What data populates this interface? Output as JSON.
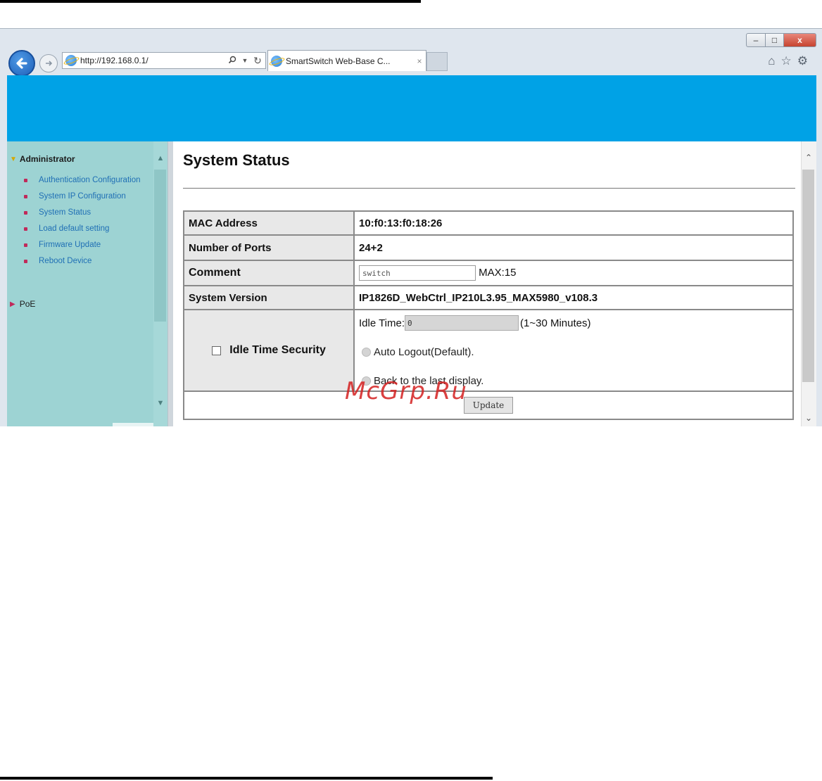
{
  "browser": {
    "address": "http://192.168.0.1/",
    "tab_title": "SmartSwitch Web-Base C...",
    "tab_close": "×",
    "window_controls": {
      "minimize": "–",
      "maximize": "□",
      "close": "x"
    },
    "icons": [
      "back-icon",
      "forward-icon",
      "search-icon",
      "refresh-icon",
      "home-icon",
      "star-icon",
      "gear-icon"
    ]
  },
  "sidebar": {
    "header": "Administrator",
    "items": [
      {
        "label": "Authentication Configuration"
      },
      {
        "label": "System IP Configuration"
      },
      {
        "label": "System Status"
      },
      {
        "label": "Load default setting"
      },
      {
        "label": "Firmware Update"
      },
      {
        "label": "Reboot Device"
      }
    ],
    "poe": "PoE"
  },
  "main": {
    "title": "System Status",
    "rows": {
      "mac_label": "MAC Address",
      "mac_value": "10:f0:13:f0:18:26",
      "ports_label": "Number of Ports",
      "ports_value": "24+2",
      "comment_label": "Comment",
      "comment_value": "switch",
      "comment_max": "MAX:15",
      "version_label": "System Version",
      "version_value": "IP1826D_WebCtrl_IP210L3.95_MAX5980_v108.3",
      "idle_security_label": "Idle Time Security",
      "idle_time_label": "Idle Time:",
      "idle_time_value": "0",
      "idle_time_range": "(1~30 Minutes)",
      "auto_logout": "Auto Logout(Default).",
      "back_last": "Back to the last display."
    },
    "update_button": "Update"
  },
  "watermark": "McGrp.Ru",
  "colors": {
    "banner": "#00a2e6",
    "sidebar": "#9dd3d3",
    "menu_link": "#1f6fb5",
    "menu_bullet": "#c02a5a",
    "watermark": "#d42020"
  }
}
